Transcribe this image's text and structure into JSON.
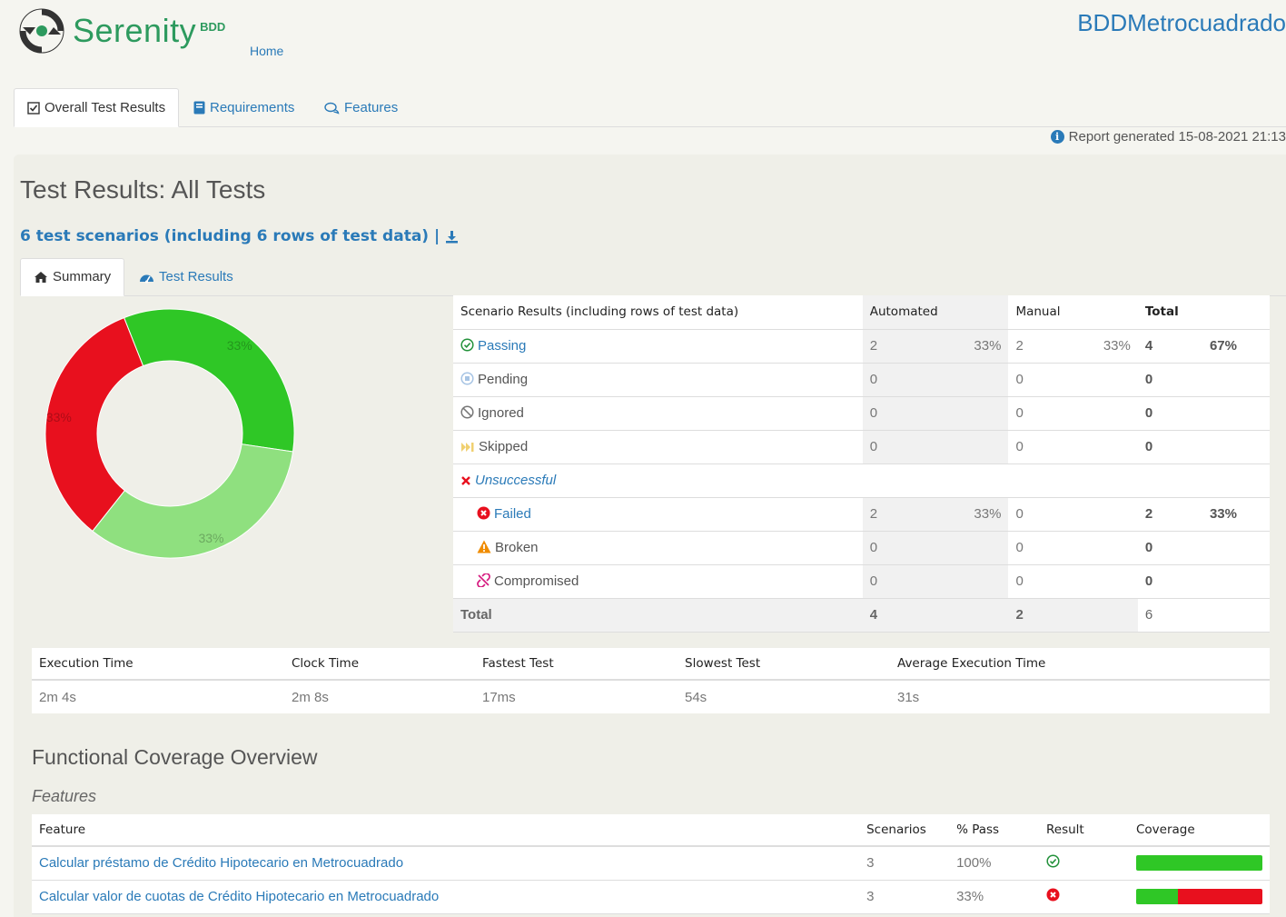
{
  "header": {
    "logo_text": "Serenity",
    "logo_suffix": "BDD",
    "home_link": "Home",
    "project_title": "BDDMetrocuadrado"
  },
  "main_tabs": [
    {
      "label": "Overall Test Results",
      "icon": "checkbox-icon"
    },
    {
      "label": "Requirements",
      "icon": "book-icon"
    },
    {
      "label": "Features",
      "icon": "chat-icon"
    }
  ],
  "report_generated": "Report generated 15-08-2021 21:13",
  "page_title": "Test Results: All Tests",
  "scenario_count": "6 test scenarios (including 6 rows of test data) |",
  "sub_tabs": [
    {
      "label": "Summary",
      "icon": "home-icon"
    },
    {
      "label": "Test Results",
      "icon": "gauge-icon"
    }
  ],
  "chart_data": {
    "type": "pie",
    "labels": [
      "Passing (Automated)",
      "Passing (Manual)",
      "Failed"
    ],
    "values": [
      33,
      33,
      33
    ],
    "value_labels": [
      "33%",
      "33%",
      "33%"
    ],
    "colors": [
      "#2fc726",
      "#8fe07f",
      "#e8101e"
    ],
    "donut": true
  },
  "results_table": {
    "headers": [
      "Scenario Results (including rows of test data)",
      "Automated",
      "",
      "Manual",
      "",
      "Total",
      ""
    ],
    "rows": [
      {
        "label": "Passing",
        "icon": "check-circle-icon",
        "auto": "2",
        "auto_pct": "33%",
        "manual": "2",
        "manual_pct": "33%",
        "total": "4",
        "total_pct": "67%"
      },
      {
        "label": "Pending",
        "icon": "pending-icon",
        "auto": "0",
        "auto_pct": "",
        "manual": "0",
        "manual_pct": "",
        "total": "0",
        "total_pct": ""
      },
      {
        "label": "Ignored",
        "icon": "ban-icon",
        "auto": "0",
        "auto_pct": "",
        "manual": "0",
        "manual_pct": "",
        "total": "0",
        "total_pct": ""
      },
      {
        "label": "Skipped",
        "icon": "skip-icon",
        "auto": "0",
        "auto_pct": "",
        "manual": "0",
        "manual_pct": "",
        "total": "0",
        "total_pct": ""
      },
      {
        "label": "Unsuccessful",
        "icon": "x-icon"
      },
      {
        "label": "Failed",
        "icon": "x-circle-icon",
        "auto": "2",
        "auto_pct": "33%",
        "manual": "0",
        "manual_pct": "",
        "total": "2",
        "total_pct": "33%"
      },
      {
        "label": "Broken",
        "icon": "warning-icon",
        "auto": "0",
        "auto_pct": "",
        "manual": "0",
        "manual_pct": "",
        "total": "0",
        "total_pct": ""
      },
      {
        "label": "Compromised",
        "icon": "broken-link-icon",
        "auto": "0",
        "auto_pct": "",
        "manual": "0",
        "manual_pct": "",
        "total": "0",
        "total_pct": ""
      }
    ],
    "total_row": {
      "label": "Total",
      "auto": "4",
      "manual": "2",
      "total": "6"
    }
  },
  "execution_table": {
    "headers": [
      "Execution Time",
      "Clock Time",
      "Fastest Test",
      "Slowest Test",
      "Average Execution Time"
    ],
    "values": [
      "2m 4s",
      "2m 8s",
      "17ms",
      "54s",
      "31s"
    ]
  },
  "coverage_title": "Functional Coverage Overview",
  "features_subtitle": "Features",
  "features_table": {
    "headers": [
      "Feature",
      "Scenarios",
      "% Pass",
      "Result",
      "Coverage"
    ],
    "rows": [
      {
        "feature": "Calcular préstamo de Crédito Hipotecario en Metrocuadrado",
        "scenarios": "3",
        "pass": "100%",
        "result": "pass",
        "coverage_pass": 1.0
      },
      {
        "feature": "Calcular valor de cuotas de Crédito Hipotecario en Metrocuadrado",
        "scenarios": "3",
        "pass": "33%",
        "result": "fail",
        "coverage_pass": 0.33
      }
    ]
  }
}
